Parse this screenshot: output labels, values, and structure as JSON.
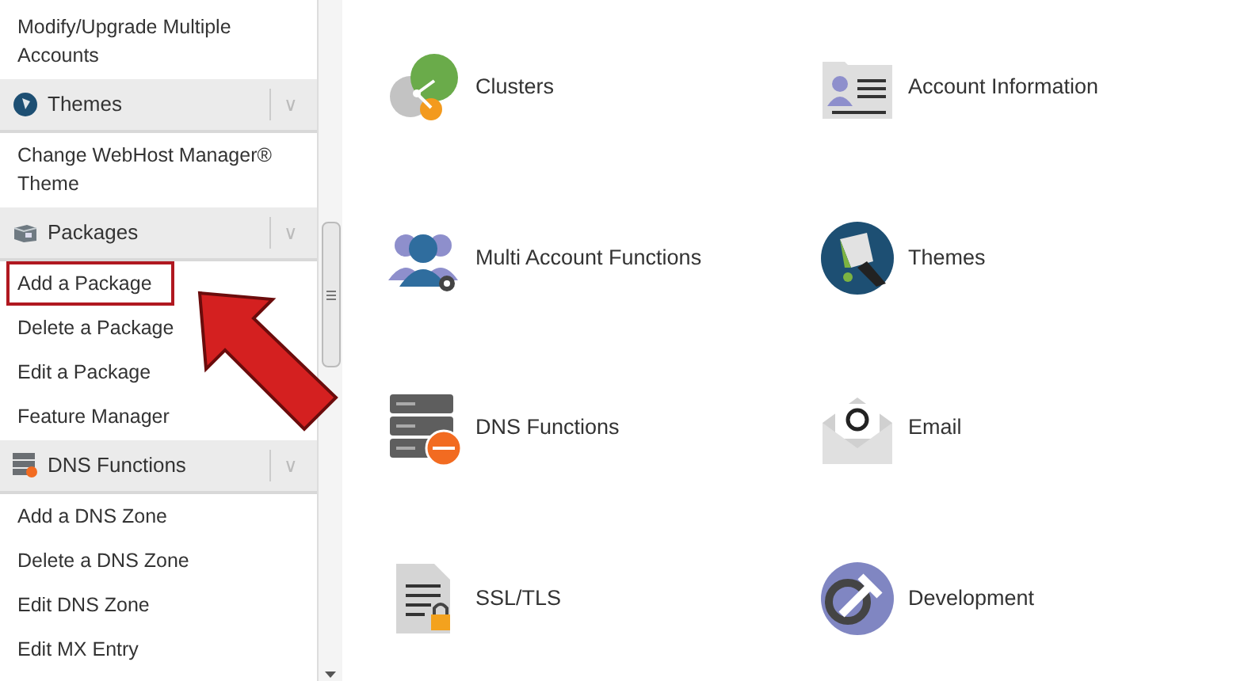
{
  "sidebar": {
    "items": [
      {
        "kind": "link",
        "label": "Modify/Upgrade Multiple Accounts",
        "selected": false
      },
      {
        "kind": "header",
        "label": "Themes",
        "chevron": "∨"
      },
      {
        "kind": "link",
        "label": "Change WebHost Manager® Theme",
        "selected": false
      },
      {
        "kind": "header",
        "label": "Packages",
        "chevron": "∨"
      },
      {
        "kind": "link",
        "label": "Add a Package",
        "selected": true
      },
      {
        "kind": "link",
        "label": "Delete a Package",
        "selected": false
      },
      {
        "kind": "link",
        "label": "Edit a Package",
        "selected": false
      },
      {
        "kind": "link",
        "label": "Feature Manager",
        "selected": false
      },
      {
        "kind": "header",
        "label": "DNS Functions",
        "chevron": "∨"
      },
      {
        "kind": "link",
        "label": "Add a DNS Zone",
        "selected": false
      },
      {
        "kind": "link",
        "label": "Delete a DNS Zone",
        "selected": false
      },
      {
        "kind": "link",
        "label": "Edit DNS Zone",
        "selected": false
      },
      {
        "kind": "link",
        "label": "Edit MX Entry",
        "selected": false
      }
    ]
  },
  "tiles": [
    {
      "kind": "clusters",
      "label": "Clusters"
    },
    {
      "kind": "account",
      "label": "Account Information"
    },
    {
      "kind": "users",
      "label": "Multi Account Functions"
    },
    {
      "kind": "themes",
      "label": "Themes"
    },
    {
      "kind": "dns",
      "label": "DNS Functions"
    },
    {
      "kind": "email",
      "label": "Email"
    },
    {
      "kind": "ssl",
      "label": "SSL/TLS"
    },
    {
      "kind": "development",
      "label": "Development"
    }
  ]
}
